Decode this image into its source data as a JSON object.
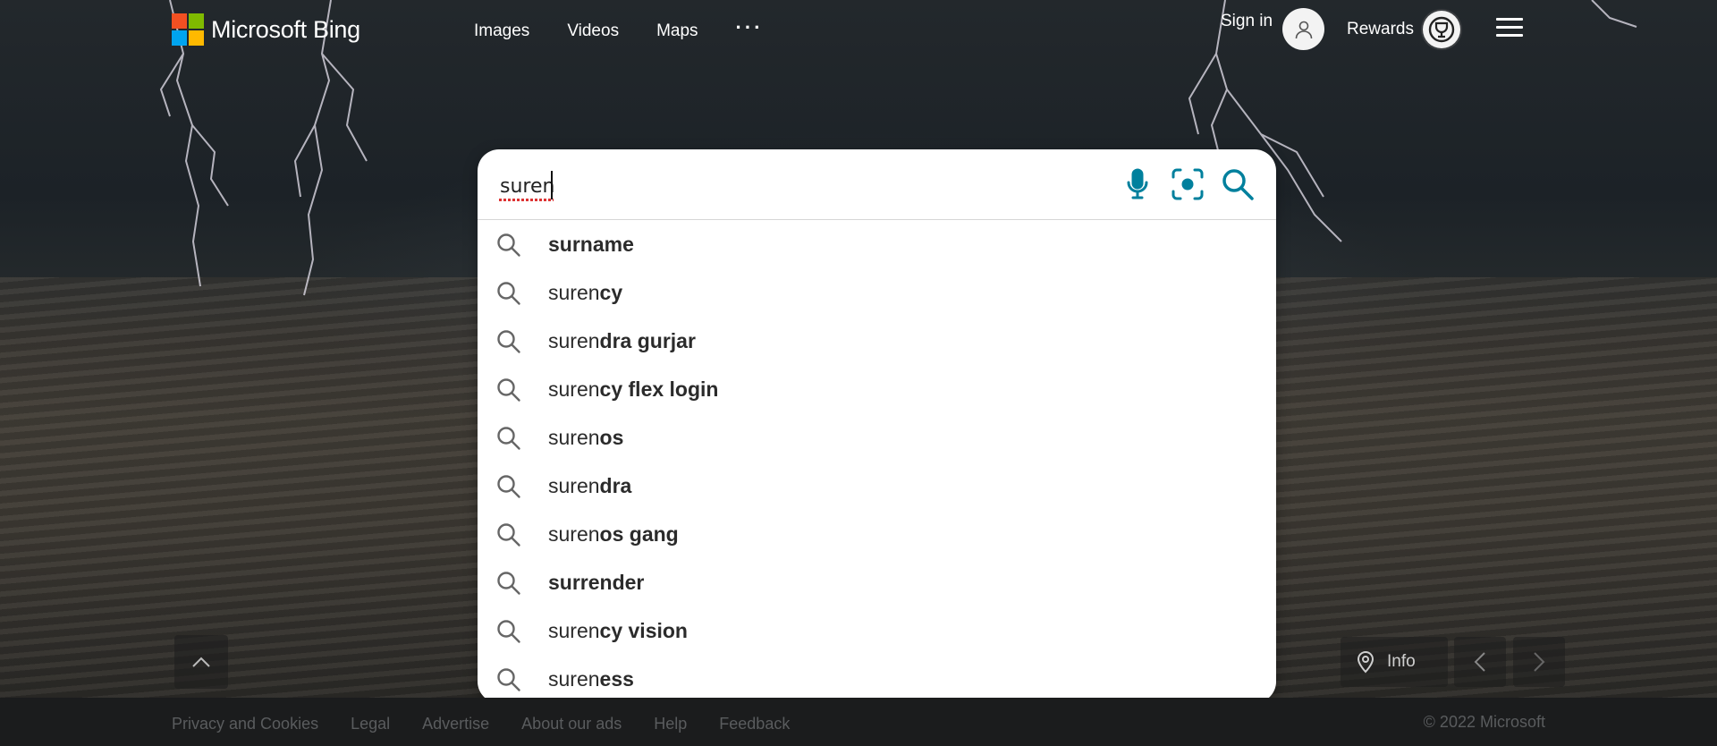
{
  "brand": {
    "name": "Microsoft Bing",
    "logo_colors": [
      "#f25022",
      "#7fba00",
      "#00a4ef",
      "#ffb900"
    ]
  },
  "nav": {
    "items": [
      "Images",
      "Videos",
      "Maps"
    ],
    "more": "···"
  },
  "account": {
    "sign_in": "Sign in",
    "rewards": "Rewards"
  },
  "search": {
    "value": "suren",
    "accent_color": "#00809d",
    "suggestions": [
      {
        "prefix": "",
        "bold": "surname"
      },
      {
        "prefix": "suren",
        "bold": "cy"
      },
      {
        "prefix": "suren",
        "bold": "dra gurjar"
      },
      {
        "prefix": "suren",
        "bold": "cy flex login"
      },
      {
        "prefix": "suren",
        "bold": "os"
      },
      {
        "prefix": "suren",
        "bold": "dra"
      },
      {
        "prefix": "suren",
        "bold": "os gang"
      },
      {
        "prefix": "",
        "bold": "surrender"
      },
      {
        "prefix": "suren",
        "bold": "cy vision"
      },
      {
        "prefix": "suren",
        "bold": "ess"
      }
    ]
  },
  "image_controls": {
    "info": "Info"
  },
  "footer": {
    "links": [
      "Privacy and Cookies",
      "Legal",
      "Advertise",
      "About our ads",
      "Help",
      "Feedback"
    ],
    "copyright": "© 2022 Microsoft"
  }
}
